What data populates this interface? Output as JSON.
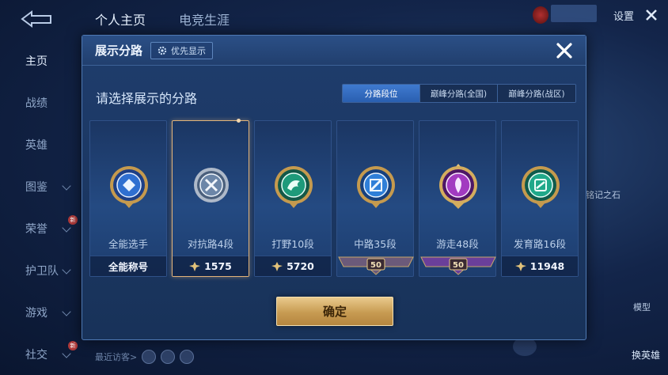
{
  "top_tabs": [
    "个人主页",
    "电竞生涯"
  ],
  "settings_label": "设置",
  "side_nav": [
    {
      "label": "主页",
      "active": true,
      "chevron": false,
      "new": false
    },
    {
      "label": "战绩",
      "active": false,
      "chevron": false,
      "new": false
    },
    {
      "label": "英雄",
      "active": false,
      "chevron": false,
      "new": false
    },
    {
      "label": "图鉴",
      "active": false,
      "chevron": true,
      "new": false
    },
    {
      "label": "荣誉",
      "active": false,
      "chevron": true,
      "new": true
    },
    {
      "label": "护卫队",
      "active": false,
      "chevron": true,
      "new": false
    },
    {
      "label": "游戏",
      "active": false,
      "chevron": true,
      "new": false
    },
    {
      "label": "社交",
      "active": false,
      "chevron": true,
      "new": true
    }
  ],
  "new_badge": "新",
  "background": {
    "recent_visitors": "最近访客>",
    "right_text_1": "铭记之石",
    "right_text_2": "模型",
    "right_text_3": "换英雄"
  },
  "dialog": {
    "title": "展示分路",
    "priority_label": "优先显示",
    "subtitle": "请选择展示的分路",
    "segments": [
      {
        "label": "分路段位",
        "active": true
      },
      {
        "label": "巅峰分路(全国)",
        "active": false
      },
      {
        "label": "巅峰分路(战区)",
        "active": false
      }
    ],
    "cards": [
      {
        "label": "全能选手",
        "footer_text": "全能称号",
        "footer_type": "text",
        "emblem": "allround-emblem-icon",
        "color": "#2f6fd0",
        "selected": false
      },
      {
        "label": "对抗路4段",
        "footer_text": "1575",
        "footer_type": "score",
        "emblem": "clash-lane-emblem-icon",
        "color": "#6c86a8",
        "selected": true
      },
      {
        "label": "打野10段",
        "footer_text": "5720",
        "footer_type": "score",
        "emblem": "jungle-emblem-icon",
        "color": "#1e9a7a",
        "selected": false
      },
      {
        "label": "中路35段",
        "footer_text": "50",
        "footer_type": "ribbon",
        "ribbon_color": "#6b5a7a",
        "emblem": "mid-lane-emblem-icon",
        "color": "#2f7fd8",
        "selected": false
      },
      {
        "label": "游走48段",
        "footer_text": "50",
        "footer_type": "ribbon",
        "ribbon_color": "#6a3f9a",
        "emblem": "roam-emblem-icon",
        "color": "#a23ac0",
        "selected": false
      },
      {
        "label": "发育路16段",
        "footer_text": "11948",
        "footer_type": "score",
        "emblem": "farm-lane-emblem-icon",
        "color": "#20a88a",
        "selected": false
      }
    ],
    "confirm_label": "确定"
  }
}
